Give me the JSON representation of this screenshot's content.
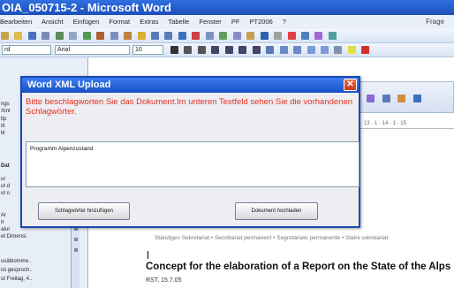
{
  "window": {
    "title": "OIA_050715-2 - Microsoft Word"
  },
  "menu": {
    "items": [
      "Bearbeiten",
      "Ansicht",
      "Einfügen",
      "Format",
      "Extras",
      "Tabelle",
      "Fenster",
      "PF",
      "PT2006",
      "?"
    ],
    "help_text": "Frage"
  },
  "toolbar": {
    "style": "rd",
    "font": "Arial",
    "size": "10"
  },
  "left_panel": {
    "snippets": [
      "ngs",
      "Xml",
      "ltp",
      "ilt",
      "ltr",
      "Dat",
      "ur",
      "ut d",
      "ut o",
      "Ar",
      "Ir",
      "atur",
      "et Dimensi.",
      "usätkomme..",
      "ist gesproch..",
      "ut Freitag, 4.."
    ]
  },
  "document": {
    "subtitle": "Ständiges Sekretariat • Secrétariat permanent • Segretariato permanente • Stalni sekretariat",
    "heading": "Concept for the elaboration of a Report on the State of the Alps",
    "line": "RST, 15.7.05"
  },
  "dialog": {
    "title": "Word XML Upload",
    "message": "Bitte beschlagworten Sie das Dokument.Im unteren Textfeld sehen Sie die vorhandenen Schlagwörter.",
    "input_value": "Programm Alpenzustand",
    "button_add": "Schlagwörter hinzufügen",
    "button_upload": "Dokument hochladen",
    "close_symbol": "✕"
  },
  "ruler": {
    "marks": "11 · 1 · 12 · 1 · 13 · 1 · 14 · 1 · 15"
  },
  "colors": {
    "title_blue": "#1d4fb8",
    "message_red": "#e0301e",
    "close_red": "#c8371a"
  }
}
